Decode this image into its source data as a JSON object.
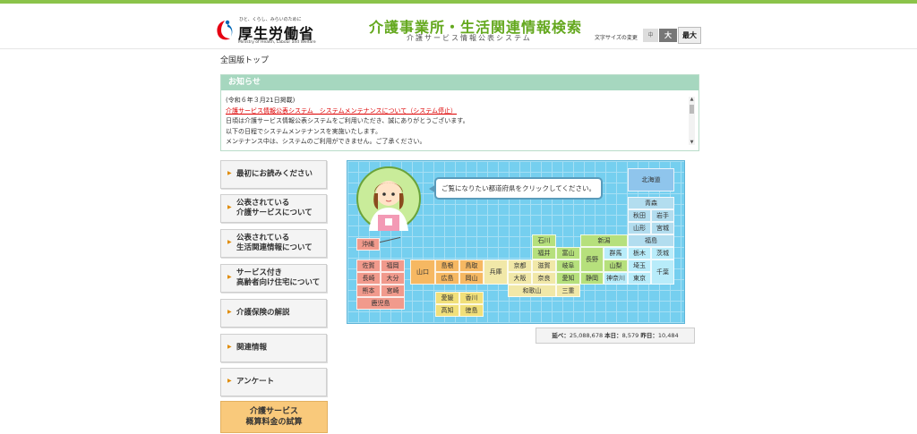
{
  "header": {
    "logo_tagline": "ひと、くらし、みらいのために",
    "logo_name": "厚生労働省",
    "logo_en": "Ministry of Health, Labour and Welfare",
    "site_title": "介護事業所・生活関連情報検索",
    "site_subtitle": "介護サービス情報公表システム",
    "font_size_label": "文字サイズの変更",
    "font_size_small": "中",
    "font_size_medium": "大",
    "font_size_large": "最大"
  },
  "breadcrumb": "全国版トップ",
  "notice": {
    "title": "お知らせ",
    "date": "(令和６年３月21日掲載)",
    "link": "介護サービス情報公表システム　システムメンテナンスについて（システム停止）",
    "lines": [
      "日頃は介護サービス情報公表システムをご利用いただき、誠にありがとうございます。",
      "以下の日程でシステムメンテナンスを実施いたします。",
      "メンテナンス中は、システムのご利用ができません。ご了承ください。"
    ]
  },
  "sidebar": {
    "items": [
      {
        "label": "最初にお読みください"
      },
      {
        "label": "公表されている\n介護サービスについて"
      },
      {
        "label": "公表されている\n生活関連情報について"
      },
      {
        "label": "サービス付き\n高齢者向け住宅について"
      },
      {
        "label": "介護保険の解説"
      },
      {
        "label": "関連情報"
      },
      {
        "label": "アンケート"
      }
    ],
    "calc_label": "介護サービス\n概算料金の試算"
  },
  "map": {
    "bubble_text": "ご覧になりたい都道府県をクリックしてください。",
    "prefectures": [
      "北海道",
      "青森",
      "秋田",
      "岩手",
      "山形",
      "宮城",
      "福島",
      "新潟",
      "石川",
      "富山",
      "福井",
      "岐阜",
      "長野",
      "群馬",
      "栃木",
      "茨城",
      "山梨",
      "埼玉",
      "千葉",
      "静岡",
      "神奈川",
      "東京",
      "愛知",
      "滋賀",
      "京都",
      "兵庫",
      "大阪",
      "奈良",
      "和歌山",
      "三重",
      "山口",
      "島根",
      "鳥取",
      "広島",
      "岡山",
      "愛媛",
      "香川",
      "高知",
      "徳島",
      "沖縄",
      "佐賀",
      "福岡",
      "長崎",
      "大分",
      "熊本",
      "宮崎",
      "鹿児島"
    ]
  },
  "counter": {
    "total_label": "延べ：",
    "total_value": "25,088,678",
    "today_label": "本日：",
    "today_value": "8,579",
    "yesterday_label": "昨日：",
    "yesterday_value": "10,484"
  },
  "colors": {
    "accent_green": "#64a81e",
    "notice_header": "#a6d7bf",
    "map_background": "#75cfef",
    "hokkaido": "#8fc5ec",
    "tohoku": "#b2ddef",
    "kanto": "#b8ecfa",
    "chubu": "#b6e07c",
    "kinki": "#f1e8a8",
    "chugoku": "#f6b862",
    "shikoku": "#f1e07a",
    "kyushu": "#f19a8c",
    "calc_button": "#f9c97b"
  }
}
